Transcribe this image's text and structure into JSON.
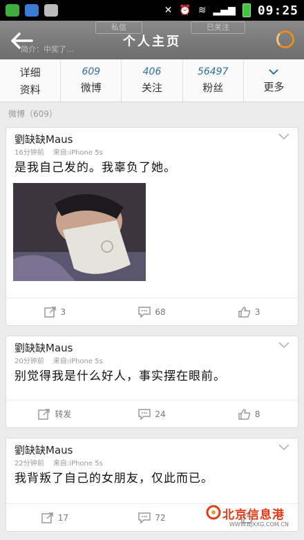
{
  "status_bar": {
    "time": "09:25"
  },
  "header": {
    "title": "个人主页",
    "ghost_left_btn": "私信",
    "ghost_right_btn": "已关注",
    "ghost_sub": "简介：中奖了…"
  },
  "stats": [
    {
      "num": "",
      "label_top": "详细",
      "label": "资料"
    },
    {
      "num": "609",
      "label": "微博"
    },
    {
      "num": "406",
      "label": "关注"
    },
    {
      "num": "56497",
      "label": "粉丝"
    },
    {
      "num": "",
      "label": "更多"
    }
  ],
  "section_label": "微博（609）",
  "posts": [
    {
      "author": "劉缺缺Maus",
      "time": "16分钟前",
      "source": "来自:iPhone 5s",
      "text": "是我自己发的。我辜负了她。",
      "repost": "3",
      "comment": "68",
      "like": "3"
    },
    {
      "author": "劉缺缺Maus",
      "time": "20分钟前",
      "source": "来自:iPhone 5s",
      "text": "别觉得我是什么好人，事实摆在眼前。",
      "repost": "转发",
      "comment": "24",
      "like": "8"
    },
    {
      "author": "劉缺缺Maus",
      "time": "22分钟前",
      "source": "来自:iPhone 5s",
      "text": "我背叛了自己的女朋友，仅此而已。",
      "repost": "17",
      "comment": "72",
      "like": ""
    }
  ],
  "watermark": {
    "name": "北京信息港",
    "url": "WWW.BJXXG.COM.CN"
  },
  "colors": {
    "accent": "#2d6fa8",
    "refresh": "#ef8a1c",
    "watermark": "#e23b16"
  }
}
